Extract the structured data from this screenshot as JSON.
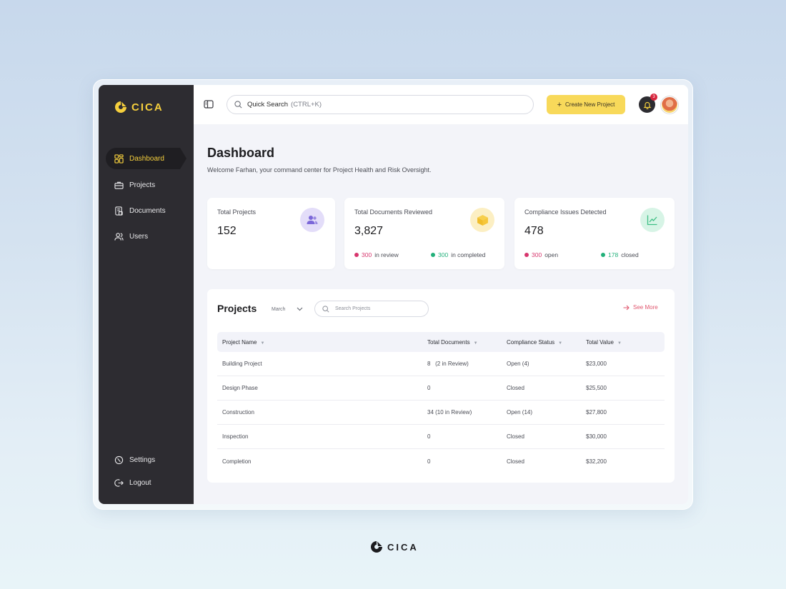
{
  "brand": {
    "name": "CICA",
    "accent": "#f5cf3d",
    "sidebar_bg": "#2d2c31"
  },
  "sidebar": {
    "items": [
      {
        "label": "Dashboard",
        "icon": "grid-icon",
        "active": true
      },
      {
        "label": "Projects",
        "icon": "briefcase-icon"
      },
      {
        "label": "Documents",
        "icon": "document-icon"
      },
      {
        "label": "Users",
        "icon": "users-icon"
      }
    ],
    "bottom": [
      {
        "label": "Settings",
        "icon": "settings-icon"
      },
      {
        "label": "Logout",
        "icon": "logout-icon"
      }
    ]
  },
  "topbar": {
    "search_label": "Quick Search",
    "search_hint": "(CTRL+K)",
    "create_label": "Create New Project",
    "notification_count": "3"
  },
  "page": {
    "title": "Dashboard",
    "subtitle": "Welcome Farhan, your command center for Project Health and Risk Oversight."
  },
  "cards": [
    {
      "label": "Total Projects",
      "value": "152",
      "icon": "users-icon"
    },
    {
      "label": "Total Documents Reviewed",
      "value": "3,827",
      "icon": "box-icon",
      "stat1_num": "300",
      "stat1_text": "in review",
      "stat2_num": "300",
      "stat2_text": "in completed"
    },
    {
      "label": "Compliance Issues Detected",
      "value": "478",
      "icon": "trend-icon",
      "stat1_num": "300",
      "stat1_text": "open",
      "stat2_num": "178",
      "stat2_text": "closed"
    }
  ],
  "projects": {
    "title": "Projects",
    "month": "March",
    "search_placeholder": "Search Projects",
    "see_more": "See More",
    "columns": [
      "Project Name",
      "Total Documents",
      "Compliance Status",
      "Total Value"
    ],
    "rows": [
      [
        "Building Project",
        "8   (2 in Review)",
        "Open (4)",
        "$23,000"
      ],
      [
        "Design Phase",
        "0",
        "Closed",
        "$25,500"
      ],
      [
        "Construction",
        "34 (10 in Review)",
        "Open (14)",
        "$27,800"
      ],
      [
        "Inspection",
        "0",
        "Closed",
        "$30,000"
      ],
      [
        "Completion",
        "0",
        "Closed",
        "$32,200"
      ]
    ]
  },
  "footer": {
    "brand": "CICA"
  }
}
